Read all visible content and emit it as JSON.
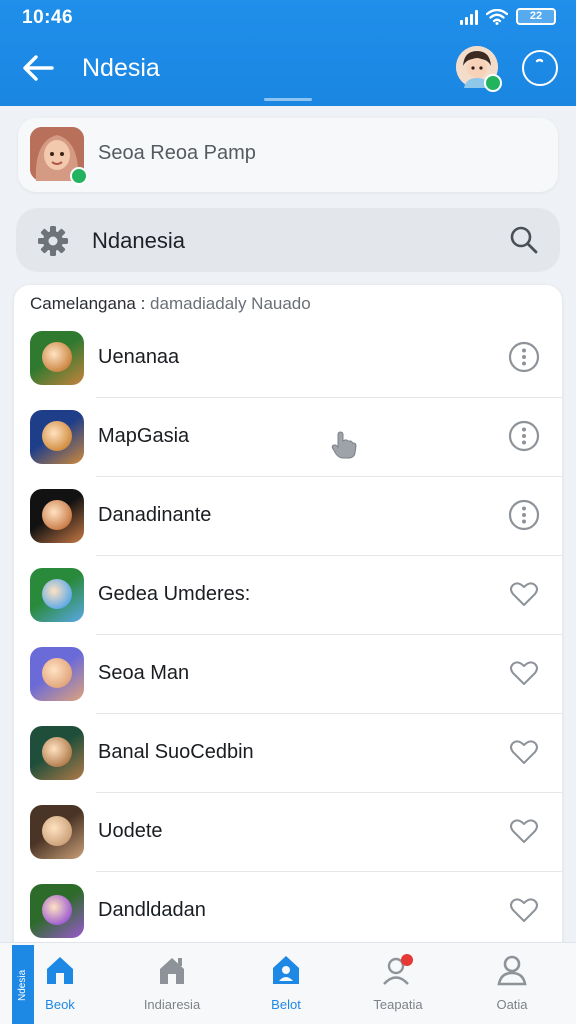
{
  "status": {
    "time": "10:46",
    "battery": "22"
  },
  "header": {
    "title": "Ndesia"
  },
  "profile": {
    "name": "Seoa Reoa Pamp"
  },
  "search": {
    "value": "Ndanesia"
  },
  "list": {
    "header_primary": "Camelangana :",
    "header_secondary": "damadiadaly Nauado",
    "items": [
      {
        "name": "Uenanaa",
        "action": "more-icon",
        "colors": [
          "#2f7a2f",
          "#c9823d"
        ]
      },
      {
        "name": "MapGasia",
        "action": "more-icon",
        "colors": [
          "#1f3e8a",
          "#d08a3a"
        ]
      },
      {
        "name": "Danadinante",
        "action": "more-icon",
        "colors": [
          "#121212",
          "#c87a45"
        ]
      },
      {
        "name": "Gedea Umderes:",
        "action": "heart-icon",
        "colors": [
          "#2a8a3b",
          "#5aa8e8"
        ]
      },
      {
        "name": "Seoa Man",
        "action": "heart-icon",
        "colors": [
          "#6a6ad8",
          "#e0a37a"
        ]
      },
      {
        "name": "Banal SuoCedbin",
        "action": "heart-icon",
        "colors": [
          "#1f4f3a",
          "#b07a4a"
        ]
      },
      {
        "name": "Uodete",
        "action": "heart-icon",
        "colors": [
          "#4a3426",
          "#caa078"
        ]
      },
      {
        "name": "Dandldadan",
        "action": "heart-icon",
        "colors": [
          "#2d6b2a",
          "#9b59d0"
        ]
      }
    ]
  },
  "nav": {
    "side_tab": "Ndesia",
    "items": [
      {
        "label": "Beok",
        "icon": "home-icon",
        "active": true
      },
      {
        "label": "Indiaresia",
        "icon": "house-icon",
        "active": false
      },
      {
        "label": "Belot",
        "icon": "account-home-icon",
        "active": true
      },
      {
        "label": "Teapatia",
        "icon": "notifications-user-icon",
        "active": false
      },
      {
        "label": "Oatia",
        "icon": "profile-icon",
        "active": false
      }
    ]
  },
  "colors": {
    "primary": "#1e88e5",
    "badge": "#22b35e",
    "notify": "#e53935"
  }
}
